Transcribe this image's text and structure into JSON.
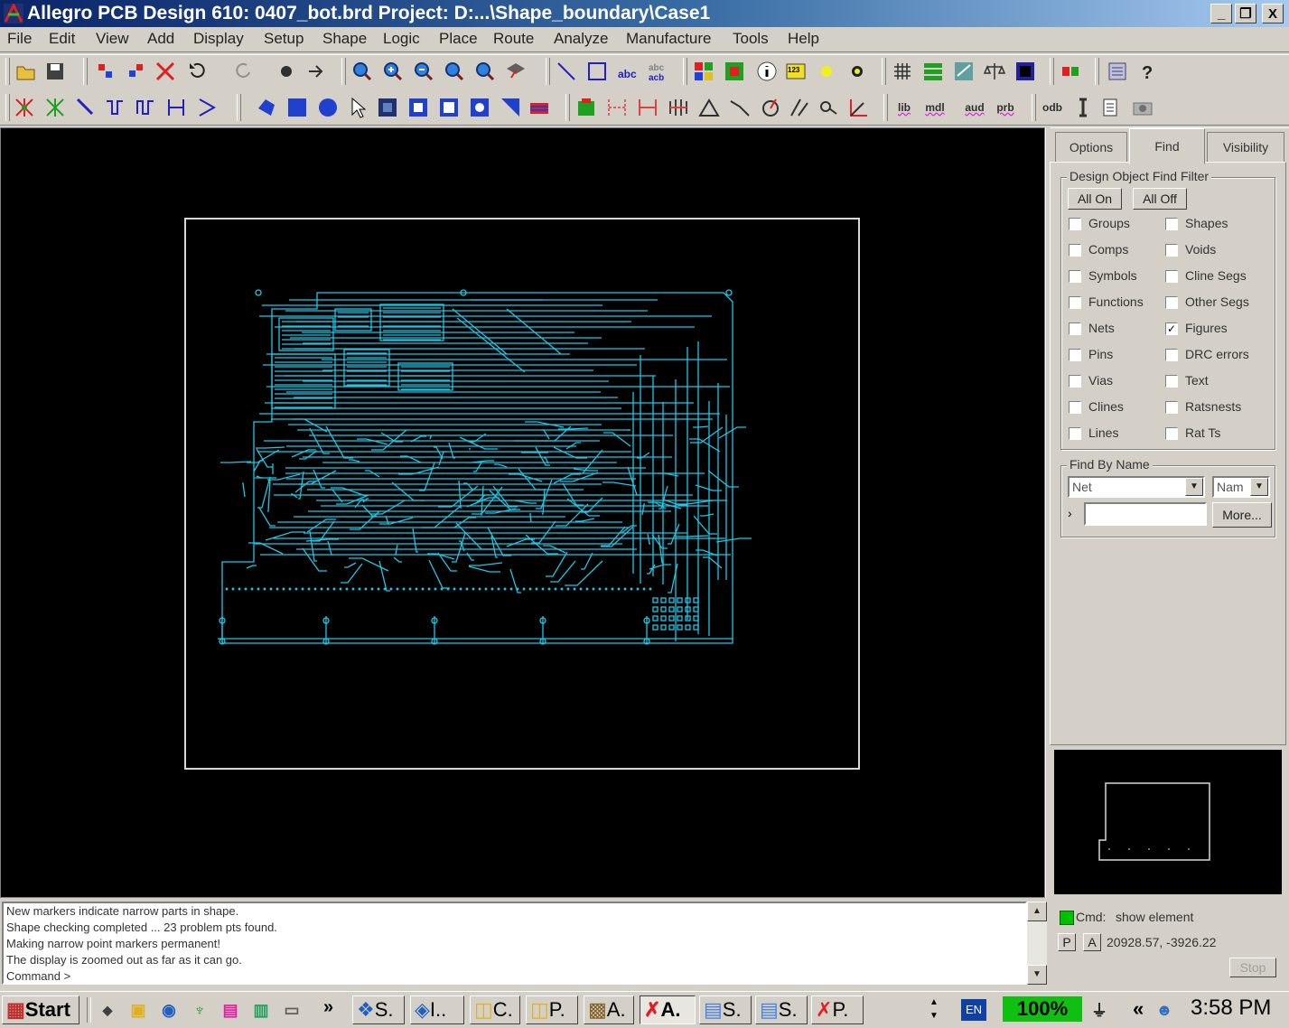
{
  "window": {
    "title": "Allegro PCB Design 610: 0407_bot.brd  Project: D:...\\Shape_boundary\\Case1",
    "minimize": "_",
    "restore": "❐",
    "close": "X"
  },
  "menu": [
    "File",
    "Edit",
    "View",
    "Add",
    "Display",
    "Setup",
    "Shape",
    "Logic",
    "Place",
    "Route",
    "Analyze",
    "Manufacture",
    "Tools",
    "Help"
  ],
  "toolbar": {
    "row1_icons": [
      "open-icon",
      "save-icon",
      "move-icon",
      "copy-icon",
      "delete-icon",
      "undo-icon",
      "redo-icon",
      "fix-icon",
      "unfix-icon",
      "zoom-fit-icon",
      "zoom-in-icon",
      "zoom-out-icon",
      "zoom-previous-icon",
      "zoom-world-icon",
      "3d-view-icon",
      "add-line-icon",
      "add-rect-icon",
      "add-text-icon",
      "change-text-icon",
      "color-icon",
      "layer-icon",
      "info-icon",
      "measure-icon",
      "highlight-icon",
      "dehighlight-icon",
      "grid-icon",
      "layer-view-icon",
      "constraint-icon",
      "balance-icon",
      "shape-icon",
      "plug-icon",
      "report-icon",
      "help-icon"
    ],
    "row2_icons": [
      "connect-icon",
      "slide-icon",
      "add-connect-icon",
      "delay-tune-icon",
      "bubble-icon",
      "custom-smooth-icon",
      "fanout-icon",
      "shape-poly-icon",
      "shape-rect-icon",
      "shape-circle-icon",
      "shape-select-icon",
      "merge-shape-icon",
      "shape-edit-icon",
      "void-icon",
      "void-rect-icon",
      "assign-net-icon",
      "dimension-icon",
      "dim-linear-icon",
      "dim-angular-icon",
      "angle-icon",
      "arc-icon",
      "circle-icon",
      "chamfer-icon",
      "fillet-icon",
      "corner-icon"
    ],
    "row2_text": [
      "lib",
      "mdl",
      "aud",
      "prb",
      "odb"
    ]
  },
  "panel": {
    "tabs": [
      "Options",
      "Find",
      "Visibility"
    ],
    "find_filter": {
      "title": "Design Object Find Filter",
      "all_on": "All On",
      "all_off": "All Off",
      "left_items": [
        {
          "label": "Groups",
          "checked": false
        },
        {
          "label": "Comps",
          "checked": false
        },
        {
          "label": "Symbols",
          "checked": false
        },
        {
          "label": "Functions",
          "checked": false
        },
        {
          "label": "Nets",
          "checked": false
        },
        {
          "label": "Pins",
          "checked": false
        },
        {
          "label": "Vias",
          "checked": false
        },
        {
          "label": "Clines",
          "checked": false
        },
        {
          "label": "Lines",
          "checked": false
        }
      ],
      "right_items": [
        {
          "label": "Shapes",
          "checked": false
        },
        {
          "label": "Voids",
          "checked": false
        },
        {
          "label": "Cline Segs",
          "checked": false
        },
        {
          "label": "Other Segs",
          "checked": false
        },
        {
          "label": "Figures",
          "checked": true
        },
        {
          "label": "DRC errors",
          "checked": false
        },
        {
          "label": "Text",
          "checked": false
        },
        {
          "label": "Ratsnests",
          "checked": false
        },
        {
          "label": "Rat Ts",
          "checked": false
        }
      ]
    },
    "find_by_name": {
      "title": "Find By Name",
      "type_value": "Net",
      "mode_value": "Nam",
      "arrow": "›",
      "input_value": "",
      "more": "More..."
    }
  },
  "console": {
    "lines": [
      "New markers indicate narrow parts in shape.",
      "Shape checking completed ... 23 problem pts found.",
      "Making narrow point markers permanent!",
      "The display is zoomed out as far as it can go.",
      "Command >"
    ]
  },
  "status": {
    "cmd_label": "Cmd:",
    "cmd_value": "show element",
    "p_btn": "P",
    "a_btn": "A",
    "coords": "20928.57, -3926.22",
    "stop": "Stop"
  },
  "colors": {
    "trace": "#1ec8e6",
    "canvas": "#000000",
    "outline": "#d8d8d8",
    "status_ok": "#00c000"
  },
  "taskbar": {
    "start": "Start",
    "chevron": "»",
    "tasks": [
      "S.",
      "I..",
      "C.",
      "P.",
      "A.",
      "A.",
      "S.",
      "S.",
      "P."
    ],
    "lang": "EN",
    "zoom": "100%",
    "collapse": "«",
    "clock": "3:58 PM"
  }
}
